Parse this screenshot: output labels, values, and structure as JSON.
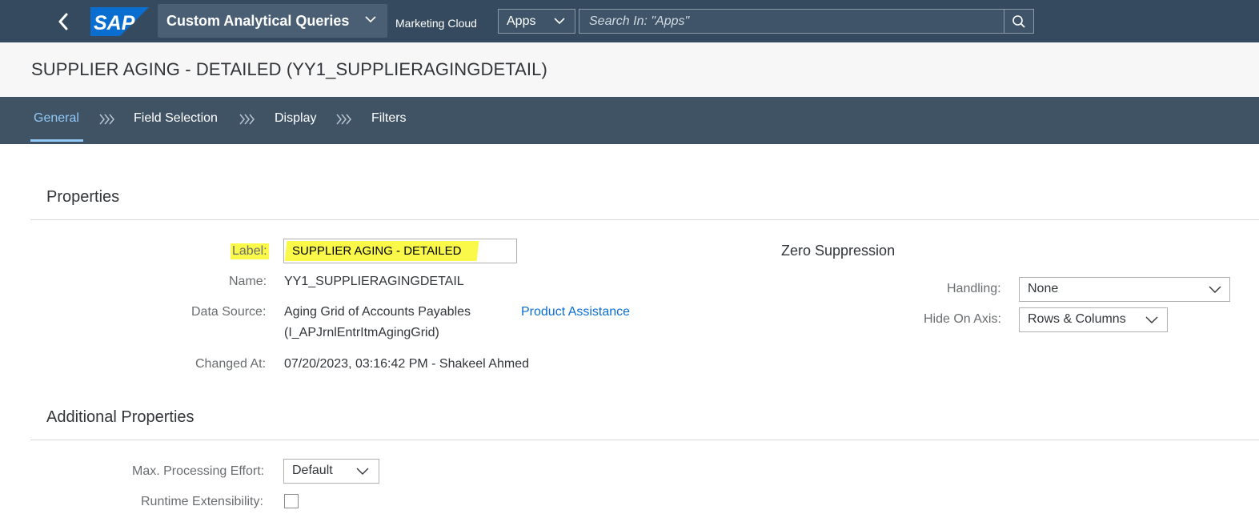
{
  "shell": {
    "logo_text": "SAP",
    "app_title": "Custom Analytical Queries",
    "product_name": "Marketing Cloud",
    "scope_select": "Apps",
    "search_placeholder": "Search In: \"Apps\"",
    "colors": {
      "shell_bg": "#354a5f",
      "logo_blue": "#0a6ed1"
    }
  },
  "header": {
    "title": "SUPPLIER AGING - DETAILED (YY1_SUPPLIERAGINGDETAIL)"
  },
  "tabs": [
    {
      "label": "General",
      "active": true
    },
    {
      "label": "Field Selection",
      "active": false
    },
    {
      "label": "Display",
      "active": false
    },
    {
      "label": "Filters",
      "active": false
    }
  ],
  "properties": {
    "section_title": "Properties",
    "label_label": "Label:",
    "label_value": "SUPPLIER AGING - DETAILED",
    "name_label": "Name:",
    "name_value": "YY1_SUPPLIERAGINGDETAIL",
    "data_source_label": "Data Source:",
    "data_source_line1": "Aging Grid of Accounts Payables",
    "data_source_line2": "(I_APJrnlEntrItmAgingGrid)",
    "product_assistance_link": "Product Assistance",
    "changed_at_label": "Changed At:",
    "changed_at_value": "07/20/2023, 03:16:42 PM - Shakeel Ahmed"
  },
  "zero_suppression": {
    "title": "Zero Suppression",
    "handling_label": "Handling:",
    "handling_value": "None",
    "hide_on_axis_label": "Hide On Axis:",
    "hide_on_axis_value": "Rows & Columns"
  },
  "additional": {
    "section_title": "Additional Properties",
    "max_effort_label": "Max. Processing Effort:",
    "max_effort_value": "Default",
    "runtime_ext_label": "Runtime Extensibility:",
    "runtime_ext_checked": false
  }
}
